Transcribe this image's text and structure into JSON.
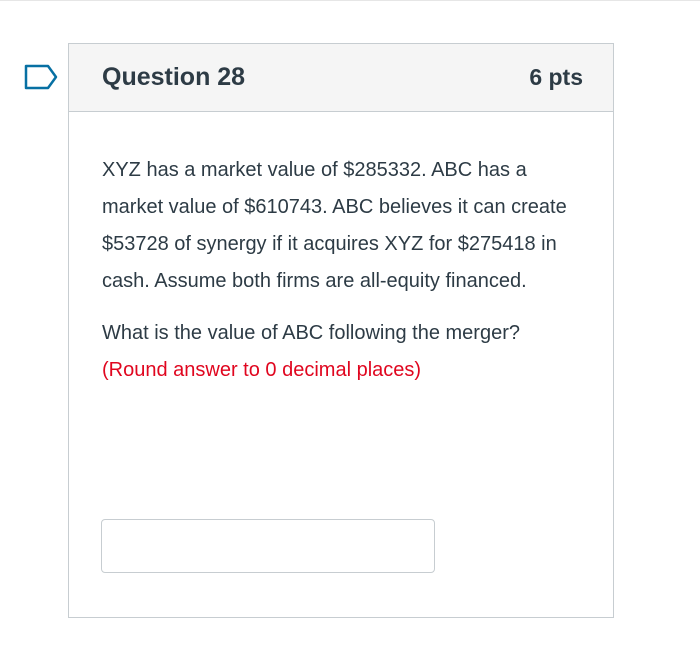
{
  "question": {
    "title": "Question 28",
    "points": "6 pts",
    "paragraph1": "XYZ has a market value of $285332. ABC has a market value of $610743. ABC believes it can create $53728 of synergy if it acquires XYZ for $275418 in cash. Assume both firms are all-equity financed.",
    "paragraph2_lead": "What is the value of ABC following the merger?",
    "paragraph2_instruction": "(Round answer to 0 decimal places)",
    "answer_value": "",
    "flag_icon": "flag-icon"
  },
  "colors": {
    "flag_outline": "#0770a3",
    "instruction_red": "#e0061f",
    "header_bg": "#f5f5f5",
    "border": "#c7cdd1",
    "text": "#2d3b45"
  }
}
